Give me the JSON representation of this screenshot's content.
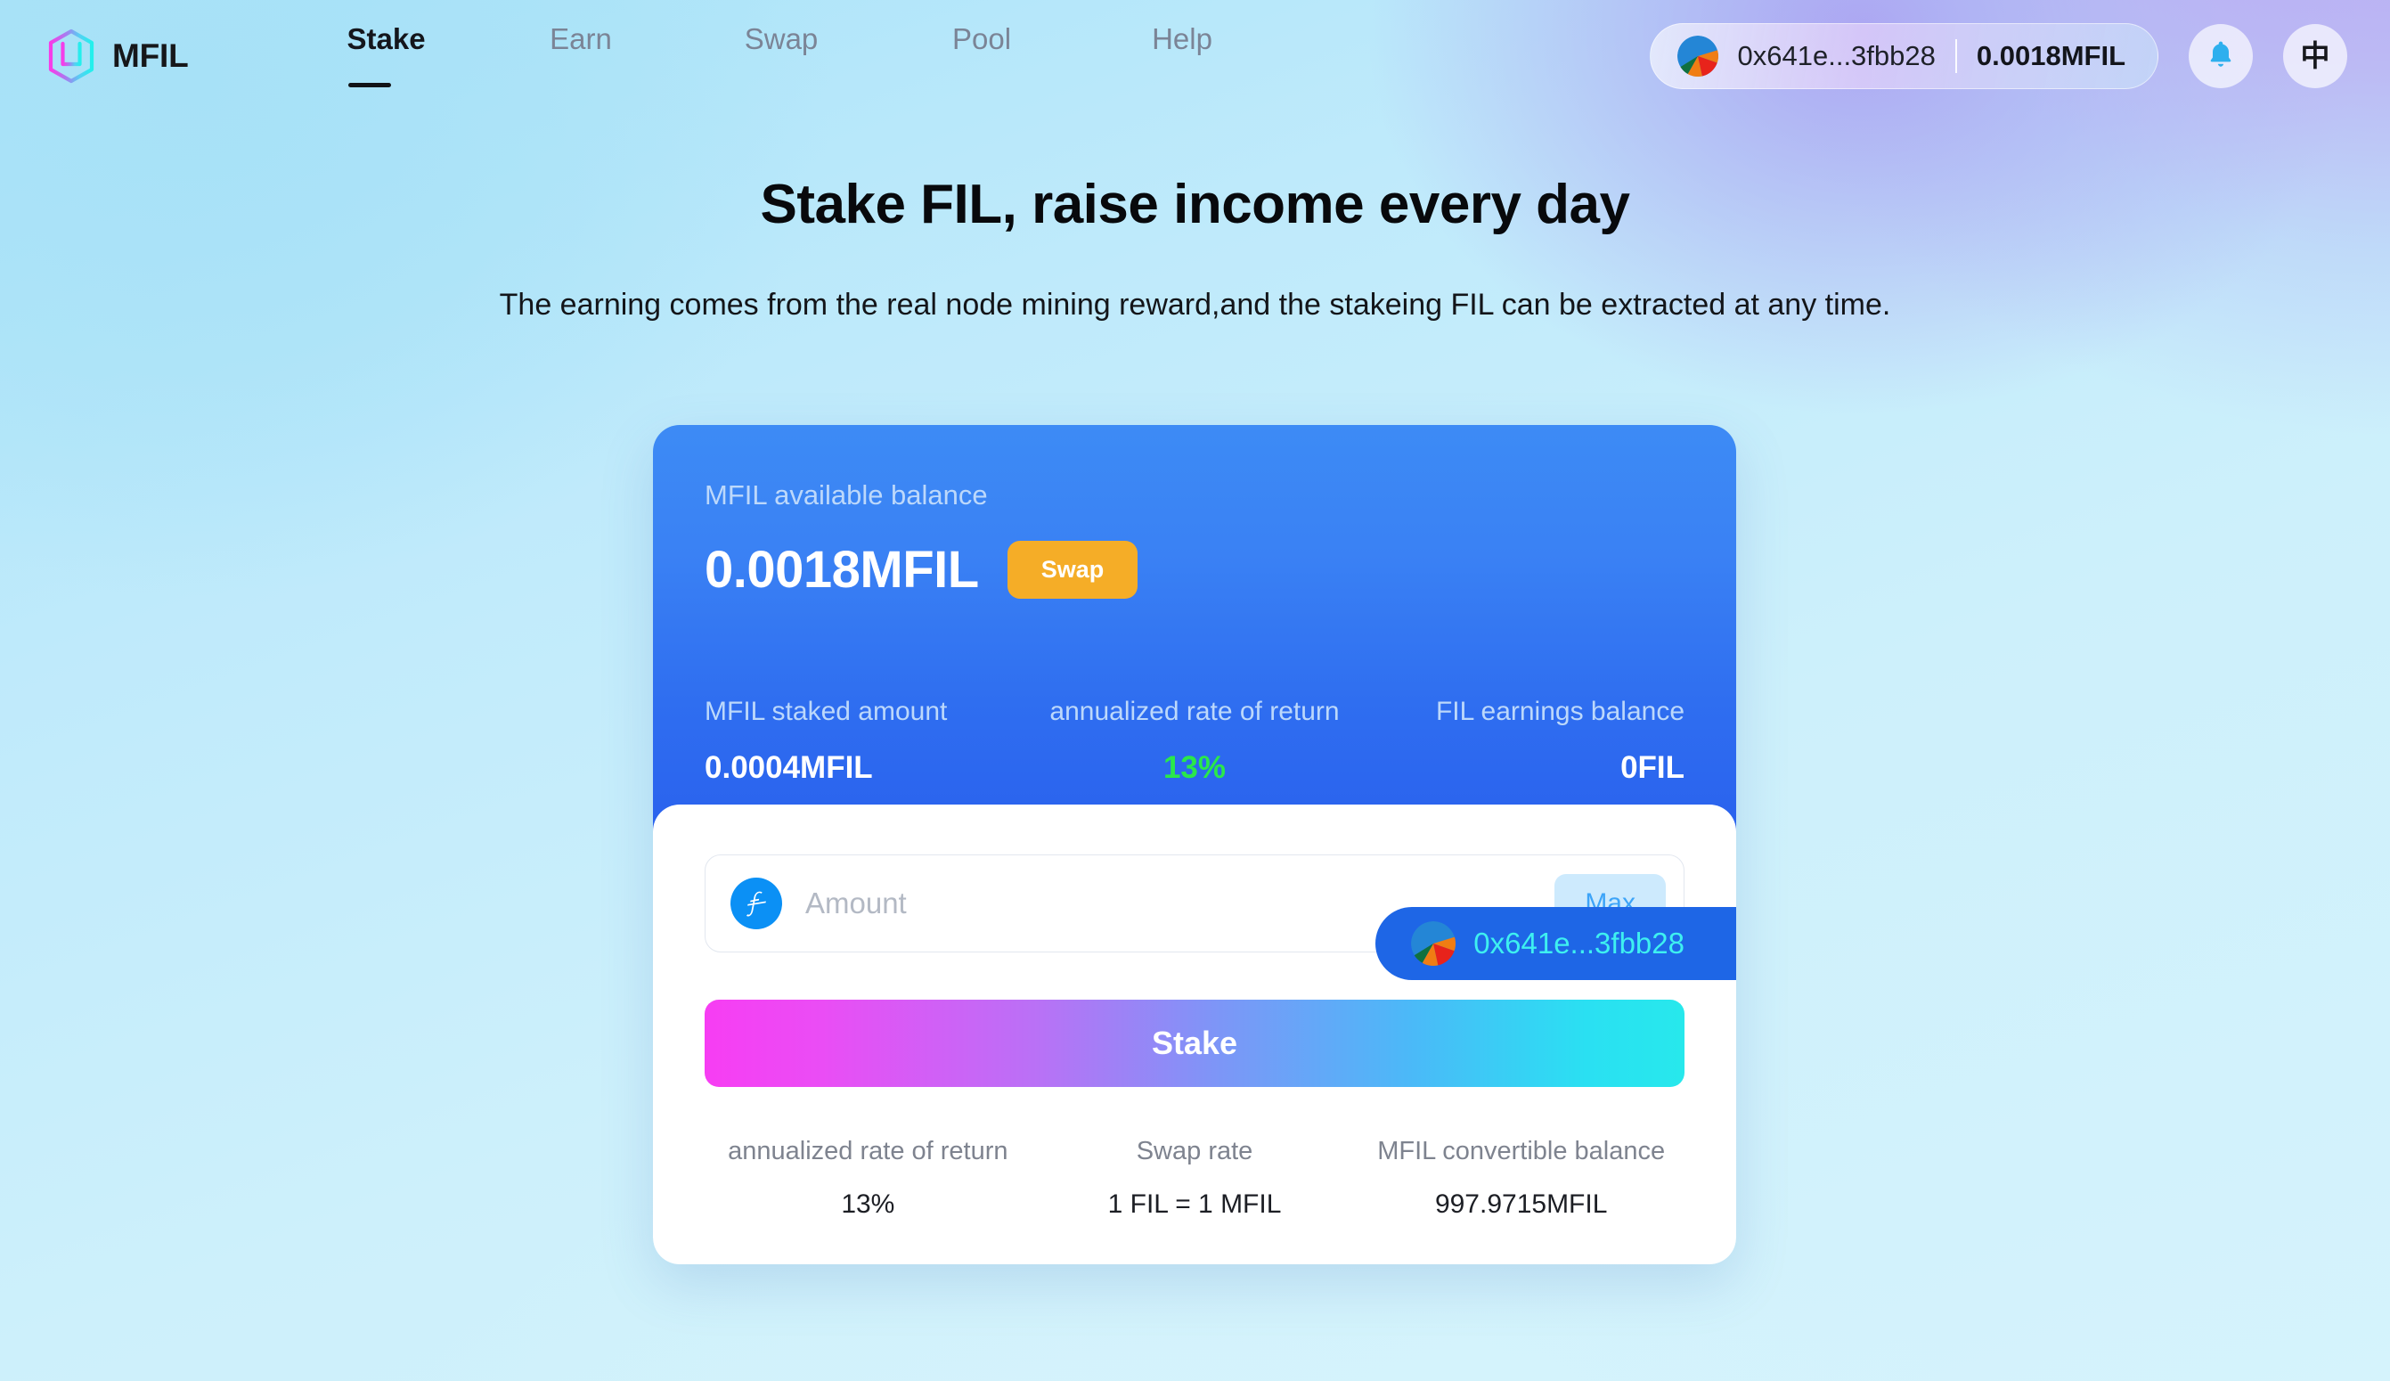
{
  "brand": {
    "name": "MFIL",
    "logo_icon": "mfil-hexagon-logo"
  },
  "nav": {
    "items": [
      {
        "label": "Stake",
        "active": true
      },
      {
        "label": "Earn",
        "active": false
      },
      {
        "label": "Swap",
        "active": false
      },
      {
        "label": "Pool",
        "active": false
      },
      {
        "label": "Help",
        "active": false
      }
    ]
  },
  "header": {
    "wallet": {
      "address": "0x641e...3fbb28",
      "balance": "0.0018MFIL",
      "avatar_icon": "wallet-jazzicon-avatar"
    },
    "notification_icon": "bell-icon",
    "language_label": "中"
  },
  "hero": {
    "title": "Stake FIL, raise income every day",
    "subtitle": "The earning comes from the real node mining reward,and the stakeing FIL can be extracted at any time."
  },
  "card": {
    "available_label": "MFIL available balance",
    "available_value": "0.0018MFIL",
    "swap_label": "Swap",
    "address": "0x641e...3fbb28",
    "address_avatar_icon": "wallet-jazzicon-avatar",
    "stats": [
      {
        "label": "MFIL staked amount",
        "value": "0.0004MFIL",
        "accent": false
      },
      {
        "label": "annualized rate of return",
        "value": "13%",
        "accent": true
      },
      {
        "label": "FIL earnings balance",
        "value": "0FIL",
        "accent": false
      }
    ]
  },
  "form": {
    "coin_icon": "filecoin-icon",
    "amount_value": "",
    "amount_placeholder": "Amount",
    "max_label": "Max",
    "submit_label": "Stake"
  },
  "footer_stats": [
    {
      "label": "annualized rate of return",
      "value": "13%"
    },
    {
      "label": "Swap rate",
      "value": "1 FIL = 1 MFIL"
    },
    {
      "label": "MFIL convertible balance",
      "value": "997.9715MFIL"
    }
  ],
  "colors": {
    "card_blue_top": "#3d8bf5",
    "card_blue_bottom": "#2a62ee",
    "swap_amber": "#f5ad27",
    "accent_green": "#2ae84a",
    "address_cyan": "#3ef0f0",
    "max_blue": "#3da4f8",
    "stake_gradient_start": "#f73df3",
    "stake_gradient_end": "#27e8ec"
  }
}
